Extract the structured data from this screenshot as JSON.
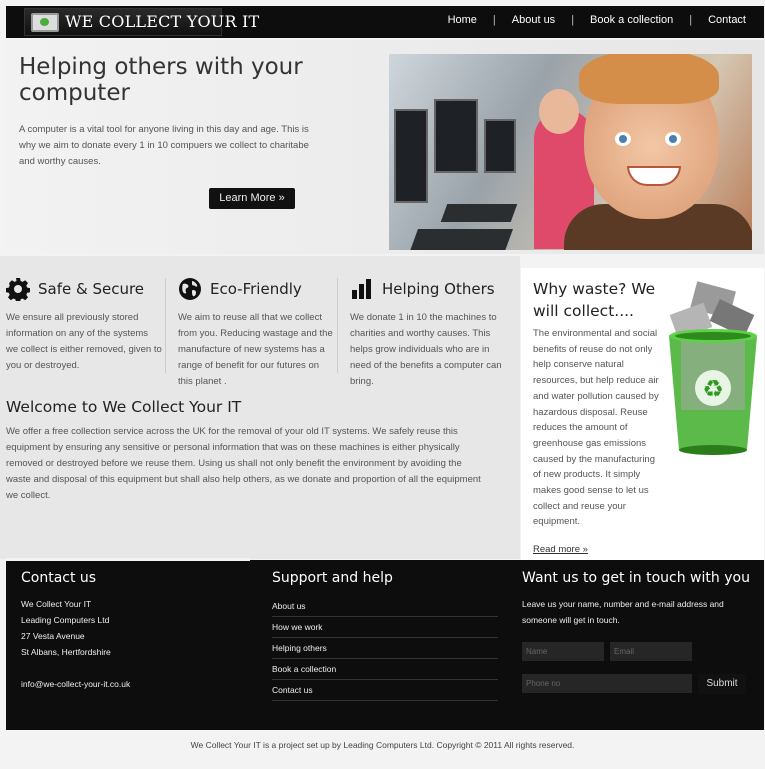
{
  "logo": {
    "text": "WE COLLECT YOUR IT",
    "icon": "recycle-monitor-icon"
  },
  "nav": [
    {
      "label": "Home"
    },
    {
      "label": "About us"
    },
    {
      "label": "Book a collection"
    },
    {
      "label": "Contact"
    }
  ],
  "hero": {
    "title": "Helping others with your computer",
    "text": "A computer is a vital tool for anyone living in this day and age. This is why we aim to donate every 1 in 10 compuers we collect to charitabe and worthy causes.",
    "button": "Learn More »"
  },
  "features": [
    {
      "title": "Safe & Secure",
      "icon": "gear-icon",
      "text": "We ensure all previously stored information on any of the systems we collect is either removed, given to you or destroyed."
    },
    {
      "title": "Eco-Friendly",
      "icon": "globe-icon",
      "text": "We aim to reuse all that we collect from you. Reducing wastage and the manufacture of new systems has a range of benefit for our futures on this planet ."
    },
    {
      "title": "Helping Others",
      "icon": "bar-chart-icon",
      "text": "We donate 1 in 10 the machines to charities and worthy causes. This helps grow individuals who are in need of the benefits a computer can bring."
    }
  ],
  "welcome": {
    "title": "Welcome to We Collect Your IT",
    "text": "We offer a free collection service across the UK for the removal of your old IT systems. We safely reuse this equipment by ensuring any sensitive or personal information that was on these machines is either physically removed or destroyed before we reuse them. Using us shall not only benefit the environment by avoiding the waste and disposal of this equipment but shall also help others, as we donate and proportion of all the equipment we collect."
  },
  "why": {
    "title": "Why waste? We will collect....",
    "text": "The environmental and social benefits of reuse do not only help conserve natural resources, but help reduce air and water pollution caused by hazardous disposal. Reuse reduces the amount of greenhouse gas emissions caused by the manufacturing of new products. It simply makes good sense to let us collect and reuse your equipment.",
    "more": "Read more »"
  },
  "footer": {
    "contact": {
      "title": "Contact us",
      "lines": [
        "We Collect Your IT",
        "Leading Computers Ltd",
        "27 Vesta Avenue",
        "St Albans, Hertfordshire"
      ],
      "email": "info@we-collect-your-it.co.uk"
    },
    "support": {
      "title": "Support and help",
      "links": [
        "About us",
        "How we work",
        "Helping others",
        "Book a collection",
        "Contact us"
      ]
    },
    "touch": {
      "title": "Want us to get in touch with you",
      "text": "Leave us your name, number and e-mail address and someone will get in touch.",
      "name_placeholder": "Name",
      "email_placeholder": "Email",
      "phone_placeholder": "Phone no",
      "submit": "Submit"
    }
  },
  "copyright": "We Collect Your IT is a project set up by Leading Computers Ltd. Copyright © 2011 All rights reserved.",
  "colors": {
    "topbar": "#0d0d0d",
    "footer": "#0d0d0d",
    "accent_green": "#4cae3a"
  }
}
